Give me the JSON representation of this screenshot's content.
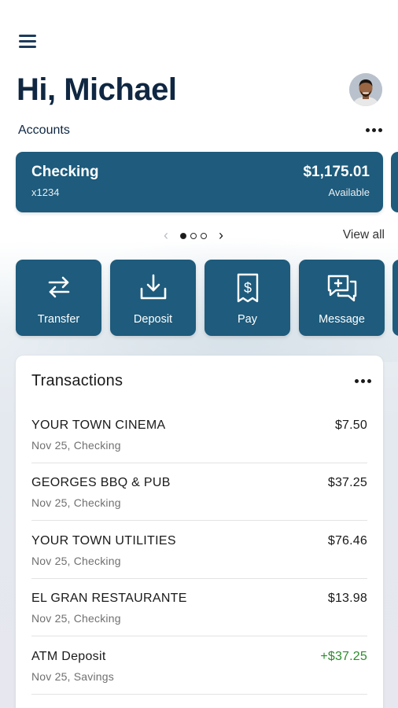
{
  "header": {
    "greeting": "Hi, Michael",
    "menu_icon": "hamburger-menu-icon",
    "avatar": "user-avatar"
  },
  "accounts": {
    "label": "Accounts",
    "more_icon": "more-horizontal-icon",
    "card": {
      "name": "Checking",
      "number": "x1234",
      "balance": "$1,175.01",
      "balance_label": "Available"
    },
    "pager": {
      "total_pages": 3,
      "current_page": 1
    },
    "view_all": "View all"
  },
  "actions": [
    {
      "label": "Transfer",
      "icon": "transfer-icon"
    },
    {
      "label": "Deposit",
      "icon": "deposit-icon"
    },
    {
      "label": "Pay",
      "icon": "pay-icon"
    },
    {
      "label": "Message",
      "icon": "message-icon"
    }
  ],
  "transactions": {
    "title": "Transactions",
    "items": [
      {
        "merchant": "YOUR TOWN CINEMA",
        "meta": "Nov 25, Checking",
        "amount": "$7.50",
        "credit": false
      },
      {
        "merchant": "GEORGES BBQ & PUB",
        "meta": "Nov 25, Checking",
        "amount": "$37.25",
        "credit": false
      },
      {
        "merchant": "YOUR TOWN UTILITIES",
        "meta": "Nov 25, Checking",
        "amount": "$76.46",
        "credit": false
      },
      {
        "merchant": "EL GRAN RESTAURANTE",
        "meta": "Nov 25, Checking",
        "amount": "$13.98",
        "credit": false
      },
      {
        "merchant": "ATM Deposit",
        "meta": "Nov 25, Savings",
        "amount": "+$37.25",
        "credit": true
      }
    ]
  },
  "colors": {
    "primary": "#1e5b7c",
    "heading": "#0f2742",
    "credit": "#2e8b2e"
  }
}
